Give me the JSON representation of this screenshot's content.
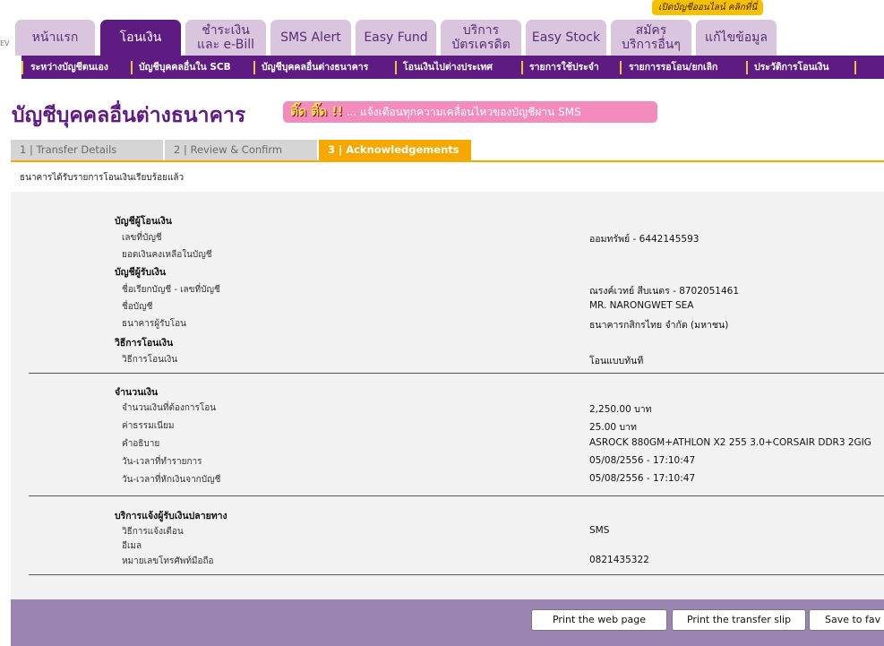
{
  "banner": {
    "open_account": "เปิดบัญชีออนไลน์ คลิกที่นี่"
  },
  "corner_text": "EV",
  "tabs": [
    {
      "label": "หน้าแรก"
    },
    {
      "label": "โอนเงิน"
    },
    {
      "label": "ชำระเงิน\nและ e-Bill"
    },
    {
      "label": "SMS Alert"
    },
    {
      "label": "Easy Fund"
    },
    {
      "label": "บริการ\nบัตรเครดิต"
    },
    {
      "label": "Easy Stock"
    },
    {
      "label": "สมัคร\nบริการอื่นๆ"
    },
    {
      "label": "แก้ไขข้อมูล"
    }
  ],
  "subnav": [
    {
      "label": "ระหว่างบัญชีตนเอง"
    },
    {
      "label": "บัญชีบุคคลอื่นใน SCB"
    },
    {
      "label": "บัญชีบุคคลอื่นต่างธนาคาร"
    },
    {
      "label": "โอนเงินไปต่างประเทศ"
    },
    {
      "label": "รายการใช้ประจำ"
    },
    {
      "label": "รายการรอโอน/ยกเลิก"
    },
    {
      "label": "ประวัติการโอนเงิน"
    }
  ],
  "page_title": "บัญชีบุคคลอื่นต่างธนาคาร",
  "promo": {
    "highlight": "ติ๊ด ติ๊ด !!",
    "text": " ... แจ้งเตือนทุกความเคลื่อนไหวของบัญชีผ่าน SMS"
  },
  "steps": [
    {
      "label": "1 | Transfer Details"
    },
    {
      "label": "2 | Review & Confirm"
    },
    {
      "label": "3 | Acknowledgements"
    }
  ],
  "ack_message": "ธนาคารได้รับรายการโอนเงินเรียบร้อยแล้ว",
  "details": {
    "from_header": "บัญชีผู้โอนเงิน",
    "account_no_label": "เลขที่บัญชี",
    "account_no_value": "ออมทรัพย์ - 6442145593",
    "balance_label": "ยอดเงินคงเหลือในบัญชี",
    "to_header": "บัญชีผู้รับเงิน",
    "nickname_label": "ชื่อเรียกบัญชี - เลขที่บัญชี",
    "nickname_value": "ณรงค์เวทย์ สีบเนตร - 8702051461",
    "name_label": "ชื่อบัญชี",
    "name_value": "MR. NARONGWET SEA",
    "bank_label": "ธนาคารผู้รับโอน",
    "bank_value": "ธนาคารกสิกรไทย จำกัด (มหาชน)",
    "method_header": "วิธีการโอนเงิน",
    "method_label": "วิธีการโอนเงิน",
    "method_value": "โอนแบบทันที",
    "amount_header": "จำนวนเงิน",
    "amount_label": "จำนวนเงินที่ต้องการโอน",
    "amount_value": "2,250.00 บาท",
    "fee_label": "ค่าธรรมเนียม",
    "fee_value": "25.00  บาท",
    "desc_label": "คำอธิบาย",
    "desc_value": "ASROCK 880GM+ATHLON X2 255 3.0+CORSAIR DDR3 2GIG",
    "txn_time_label": "วัน-เวลาที่ทำรายการ",
    "txn_time_value": "05/08/2556 - 17:10:47",
    "debit_time_label": "วัน-เวลาที่หักเงินจากบัญชี",
    "debit_time_value": "05/08/2556 - 17:10:47",
    "notify_header": "บริการแจ้งผู้รับเงินปลายทาง",
    "notify_method_label": "วิธีการแจ้งเตือน",
    "notify_method_value": "SMS",
    "email_label": "อีเมล",
    "mobile_label": "หมายเลขโทรศัพท์มือถือ",
    "mobile_value": "0821435322"
  },
  "buttons": {
    "print_page": "Print the web page",
    "print_slip": "Print the transfer slip",
    "save_fav": "Save to fav"
  },
  "colors": {
    "brand_purple": "#5e1c83",
    "accent_orange": "#f5a800",
    "tab_inactive": "#d9c6de",
    "footer": "#9b84b2"
  }
}
